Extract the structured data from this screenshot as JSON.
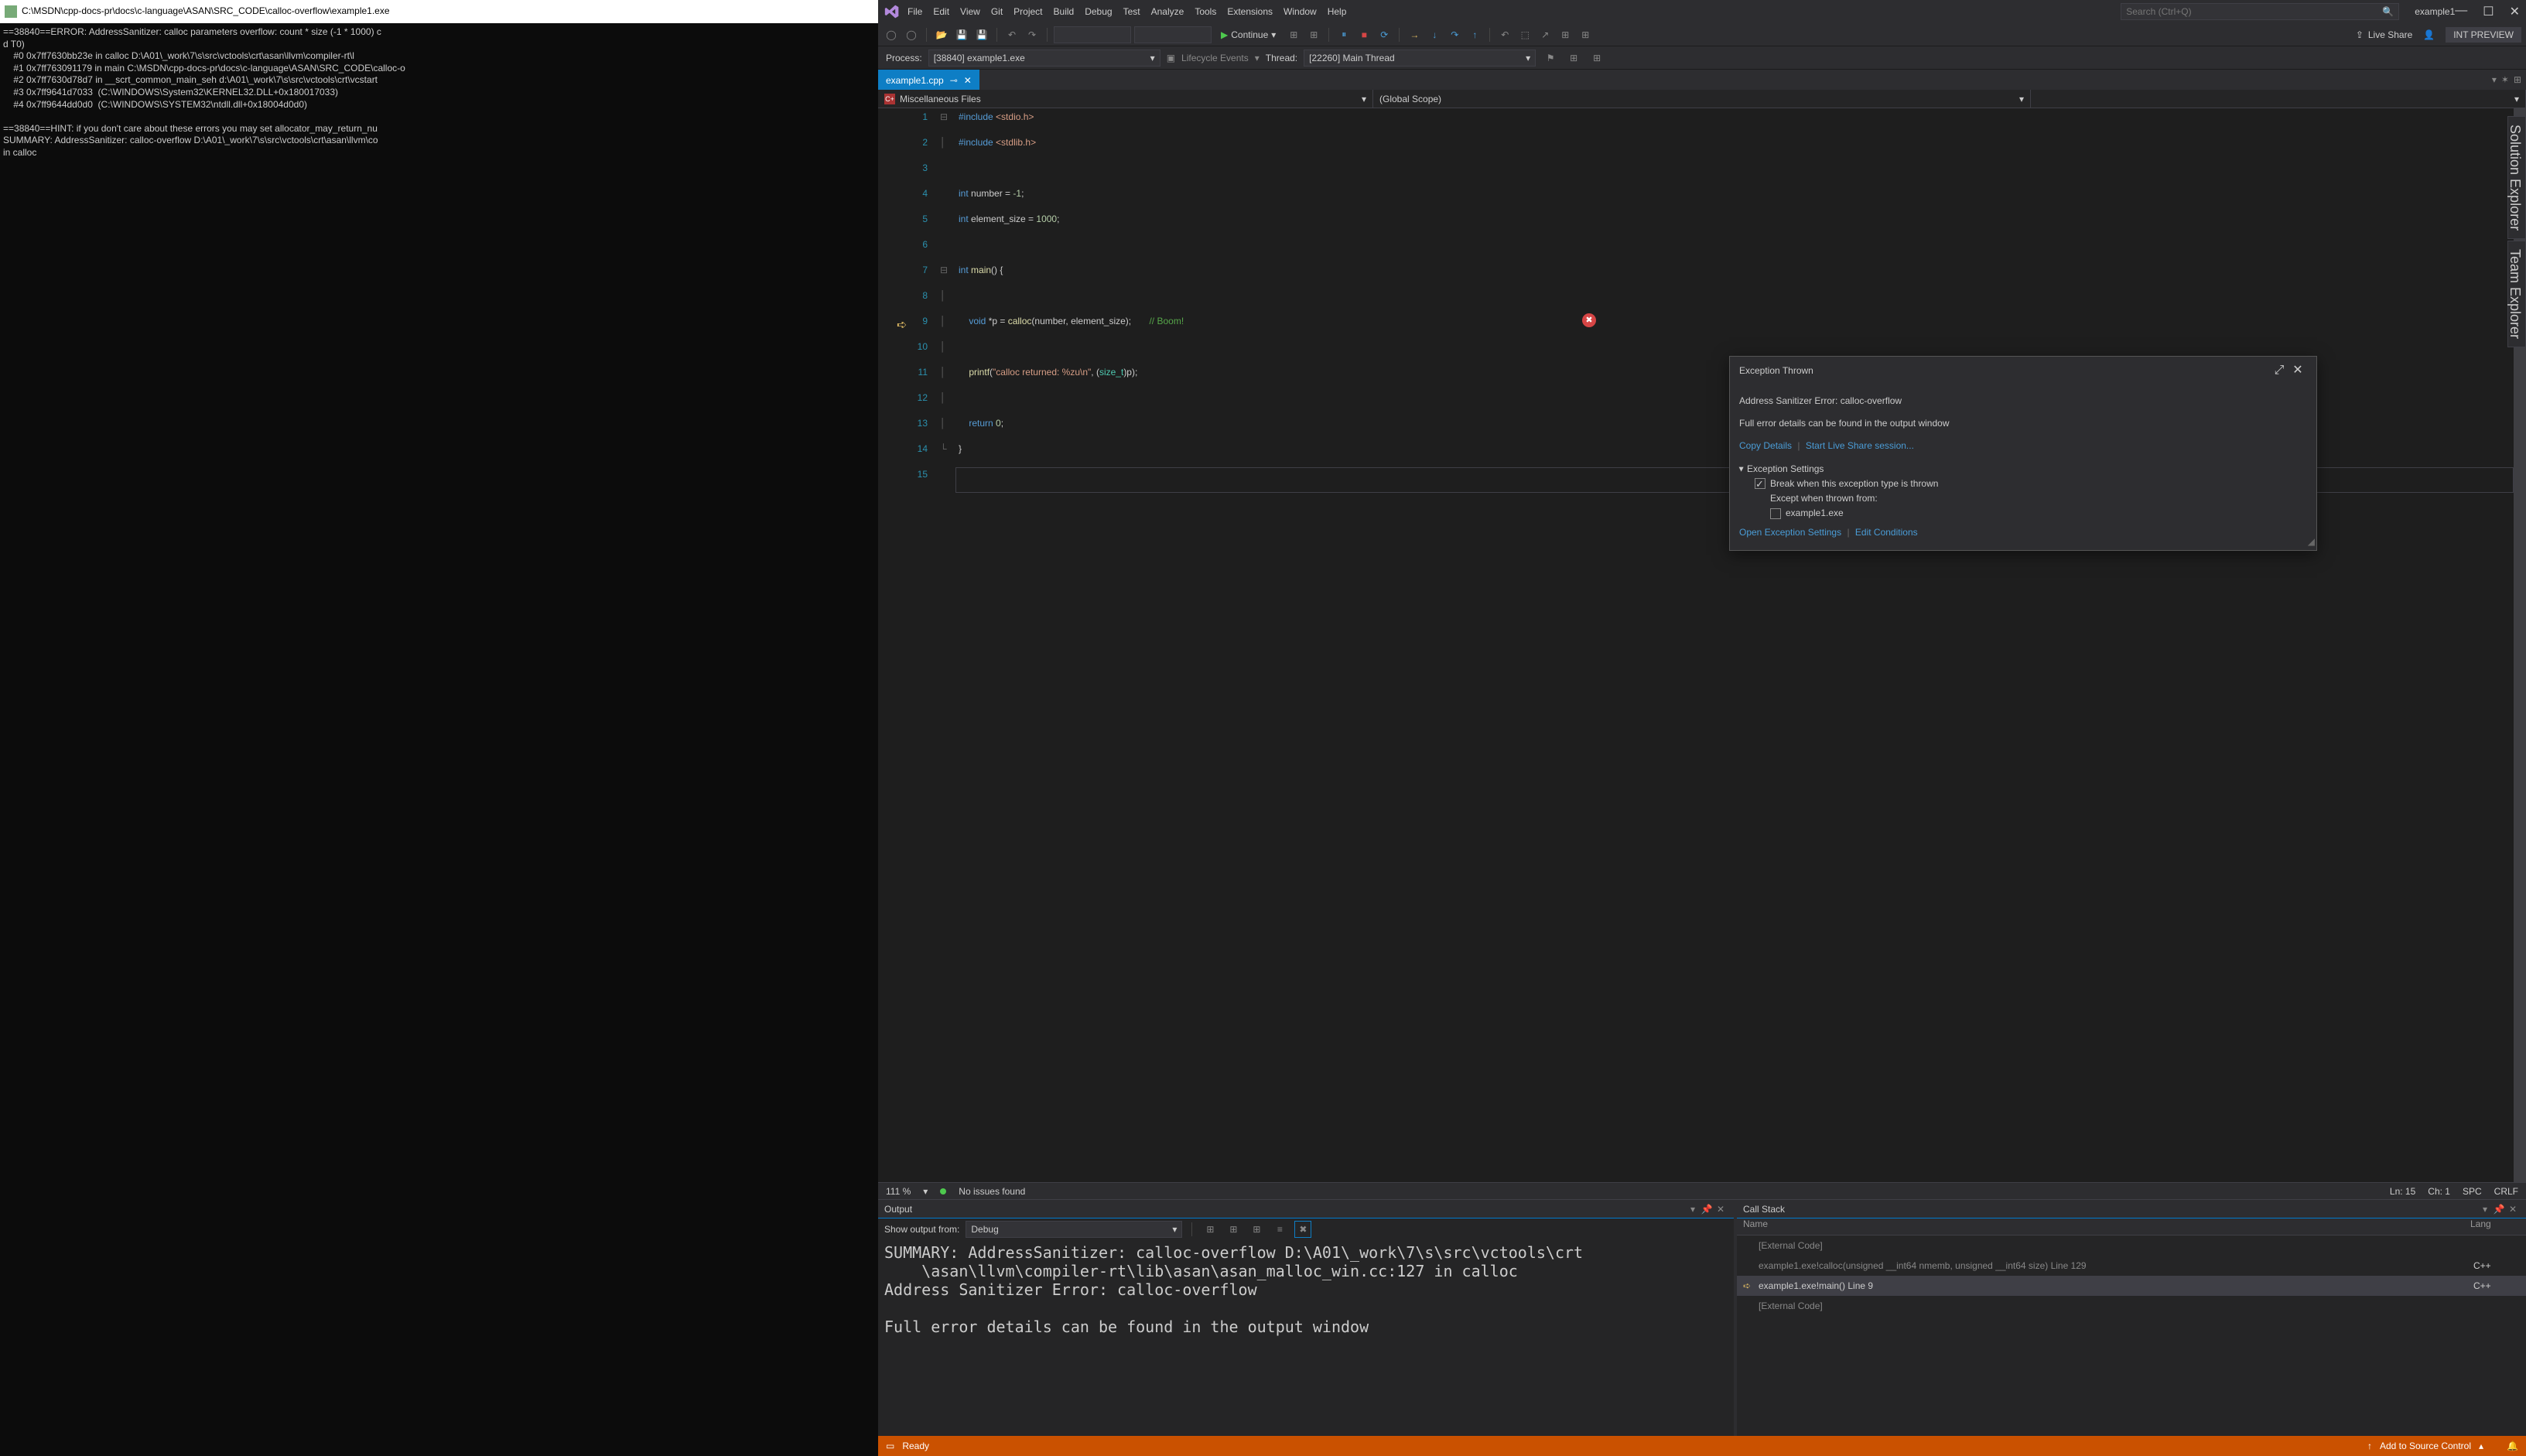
{
  "console": {
    "title": "C:\\MSDN\\cpp-docs-pr\\docs\\c-language\\ASAN\\SRC_CODE\\calloc-overflow\\example1.exe",
    "body": "==38840==ERROR: AddressSanitizer: calloc parameters overflow: count * size (-1 * 1000) c\nd T0)\n    #0 0x7ff7630bb23e in calloc D:\\A01\\_work\\7\\s\\src\\vctools\\crt\\asan\\llvm\\compiler-rt\\l\n    #1 0x7ff763091179 in main C:\\MSDN\\cpp-docs-pr\\docs\\c-language\\ASAN\\SRC_CODE\\calloc-o\n    #2 0x7ff7630d78d7 in __scrt_common_main_seh d:\\A01\\_work\\7\\s\\src\\vctools\\crt\\vcstart\n    #3 0x7ff9641d7033  (C:\\WINDOWS\\System32\\KERNEL32.DLL+0x180017033)\n    #4 0x7ff9644dd0d0  (C:\\WINDOWS\\SYSTEM32\\ntdll.dll+0x18004d0d0)\n\n==38840==HINT: if you don't care about these errors you may set allocator_may_return_nu\nSUMMARY: AddressSanitizer: calloc-overflow D:\\A01\\_work\\7\\s\\src\\vctools\\crt\\asan\\llvm\\co\nin calloc"
  },
  "vs": {
    "solution": "example1",
    "search_placeholder": "Search (Ctrl+Q)",
    "menu": [
      "File",
      "Edit",
      "View",
      "Git",
      "Project",
      "Build",
      "Debug",
      "Test",
      "Analyze",
      "Tools",
      "Extensions",
      "Window",
      "Help"
    ],
    "continue": "Continue",
    "liveshare": "Live Share",
    "int_preview": "INT PREVIEW",
    "debugbar": {
      "process_label": "Process:",
      "process": "[38840] example1.exe",
      "lifecycle": "Lifecycle Events",
      "thread_label": "Thread:",
      "thread": "[22260] Main Thread"
    },
    "tab": "example1.cpp",
    "scope1": "Miscellaneous Files",
    "scope2": "(Global Scope)",
    "code": {
      "lines": [
        1,
        2,
        3,
        4,
        5,
        6,
        7,
        8,
        9,
        10,
        11,
        12,
        13,
        14,
        15
      ]
    },
    "editor_status": {
      "zoom": "111 %",
      "issues": "No issues found",
      "ln": "Ln: 15",
      "ch": "Ch: 1",
      "spc": "SPC",
      "crlf": "CRLF"
    },
    "exception": {
      "title": "Exception Thrown",
      "heading": "Address Sanitizer Error: calloc-overflow",
      "detail": "Full error details can be found in the output window",
      "copy": "Copy Details",
      "start_share": "Start Live Share session...",
      "settings_hdr": "Exception Settings",
      "break_when": "Break when this exception type is thrown",
      "except_from": "Except when thrown from:",
      "except_item": "example1.exe",
      "open_settings": "Open Exception Settings",
      "edit_cond": "Edit Conditions"
    },
    "output": {
      "title": "Output",
      "show_from": "Show output from:",
      "source": "Debug",
      "body": "SUMMARY: AddressSanitizer: calloc-overflow D:\\A01\\_work\\7\\s\\src\\vctools\\crt\n    \\asan\\llvm\\compiler-rt\\lib\\asan\\asan_malloc_win.cc:127 in calloc\nAddress Sanitizer Error: calloc-overflow\n\nFull error details can be found in the output window"
    },
    "callstack": {
      "title": "Call Stack",
      "col_name": "Name",
      "col_lang": "Lang",
      "rows": [
        {
          "name": "[External Code]",
          "lang": "",
          "dim": true,
          "active": false,
          "arrow": false
        },
        {
          "name": "example1.exe!calloc(unsigned __int64 nmemb, unsigned __int64 size) Line 129",
          "lang": "C++",
          "dim": true,
          "active": false,
          "arrow": false
        },
        {
          "name": "example1.exe!main() Line 9",
          "lang": "C++",
          "dim": false,
          "active": true,
          "arrow": true
        },
        {
          "name": "[External Code]",
          "lang": "",
          "dim": true,
          "active": false,
          "arrow": false
        }
      ]
    },
    "statusbar": {
      "ready": "Ready",
      "source_control": "Add to Source Control"
    },
    "side_tabs": [
      "Solution Explorer",
      "Team Explorer"
    ]
  }
}
